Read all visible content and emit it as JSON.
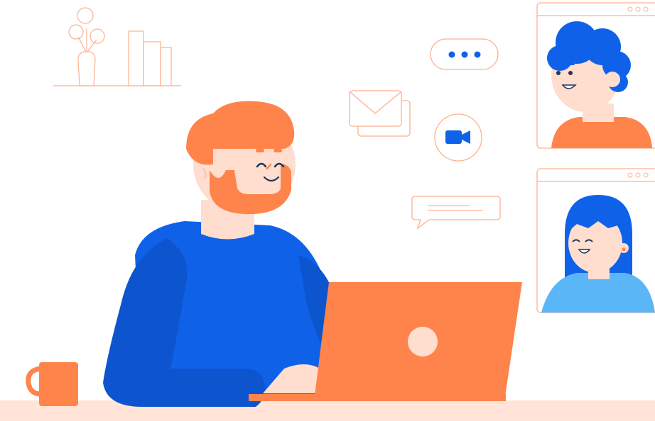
{
  "illustration": {
    "subject": "video-call",
    "icons": [
      "typing-bubble-icon",
      "envelope-icon",
      "video-camera-icon",
      "chat-message-icon"
    ],
    "colors": {
      "background": "#ffffff",
      "orange": "#ff844b",
      "blue": "#0f62e8",
      "light_blue": "#5bb6f7",
      "skin": "#ffddcf",
      "peach": "#ffe4d7",
      "outline": "#ffb08f"
    }
  }
}
